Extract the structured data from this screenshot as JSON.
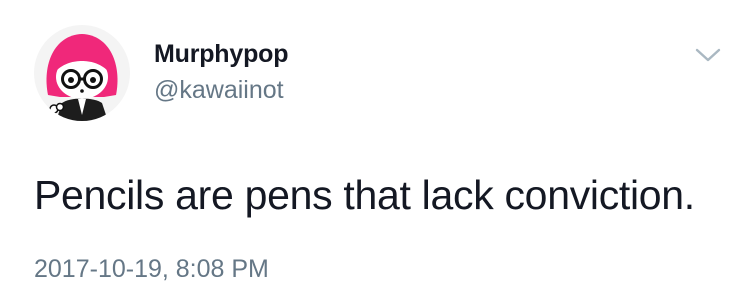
{
  "tweet": {
    "author": {
      "display_name": "Murphypop",
      "handle": "@kawaiinot",
      "avatar_icon": "cartoon-girl-pink-hair-glasses-avatar"
    },
    "text": "Pencils are pens that lack conviction.",
    "timestamp": "2017-10-19, 8:08 PM",
    "menu_icon": "chevron-down-icon"
  },
  "colors": {
    "name": "#141823",
    "secondary": "#657786",
    "hair": "#f0287a",
    "chevron": "#aab8c2"
  }
}
